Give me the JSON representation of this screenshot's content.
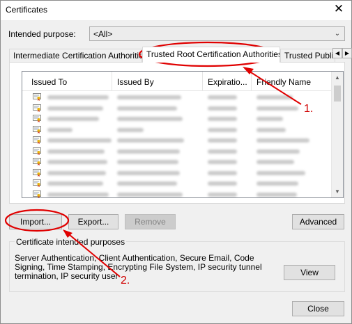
{
  "window": {
    "title": "Certificates",
    "close_glyph": "✕"
  },
  "intended_purpose": {
    "label": "Intended purpose:",
    "value": "<All>"
  },
  "tabs": [
    {
      "label": "Intermediate Certification Authorities",
      "selected": false
    },
    {
      "label": "Trusted Root Certification Authorities",
      "selected": true
    },
    {
      "label": "Trusted Publi",
      "selected": false
    }
  ],
  "columns": [
    "Issued To",
    "Issued By",
    "Expiratio...",
    "Friendly Name"
  ],
  "rows_visible": 10,
  "buttons": {
    "import": "Import...",
    "export": "Export...",
    "remove": "Remove",
    "advanced": "Advanced",
    "view": "View",
    "close": "Close"
  },
  "purposes": {
    "legend": "Certificate intended purposes",
    "text": "Server Authentication, Client Authentication, Secure Email, Code Signing, Time Stamping, Encrypting File System, IP security tunnel termination, IP security user"
  },
  "annotations": {
    "step1": "1.",
    "step2": "2.",
    "color": "#e00000"
  },
  "icons": [
    "close-icon",
    "dropdown-chevron-icon",
    "tab-scroll-left-icon",
    "tab-scroll-right-icon",
    "certificate-icon",
    "scroll-up-icon",
    "scroll-down-icon"
  ]
}
